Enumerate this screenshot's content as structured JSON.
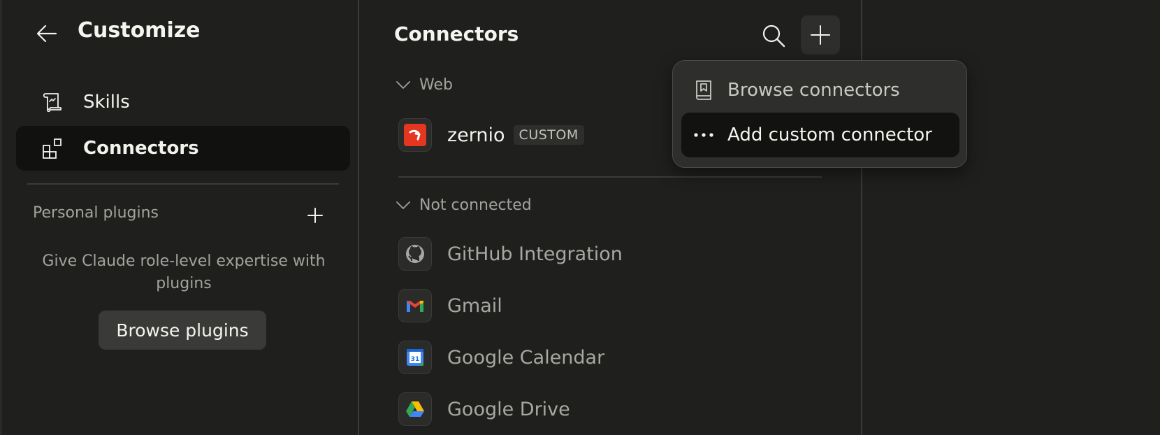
{
  "sidebar": {
    "title": "Customize",
    "nav": [
      {
        "label": "Skills",
        "icon": "scroll-icon",
        "active": false
      },
      {
        "label": "Connectors",
        "icon": "connectors-icon",
        "active": true
      }
    ],
    "section_label": "Personal plugins",
    "hint": "Give Claude role-level expertise with plugins",
    "browse_plugins_label": "Browse plugins"
  },
  "main": {
    "title": "Connectors",
    "groups": [
      {
        "label": "Web",
        "connectors": [
          {
            "name": "zernio",
            "badge": "CUSTOM",
            "icon": "zernio-logo-icon"
          }
        ]
      },
      {
        "label": "Not connected",
        "connectors": [
          {
            "name": "GitHub Integration",
            "icon": "github-icon"
          },
          {
            "name": "Gmail",
            "icon": "gmail-icon"
          },
          {
            "name": "Google Calendar",
            "icon": "google-calendar-icon",
            "icon_text": "31"
          },
          {
            "name": "Google Drive",
            "icon": "google-drive-icon"
          }
        ]
      }
    ]
  },
  "dropdown": {
    "items": [
      {
        "label": "Browse connectors",
        "icon": "book-icon"
      },
      {
        "label": "Add custom connector",
        "icon": "more-dots-icon"
      }
    ]
  },
  "colors": {
    "background": "#1f1f1e",
    "active_nav": "#111110",
    "zernio_red": "#e5361f",
    "gmail_red": "#ea4335",
    "google_blue": "#4285f4",
    "google_green": "#34a853",
    "google_yellow": "#fbbc04"
  }
}
